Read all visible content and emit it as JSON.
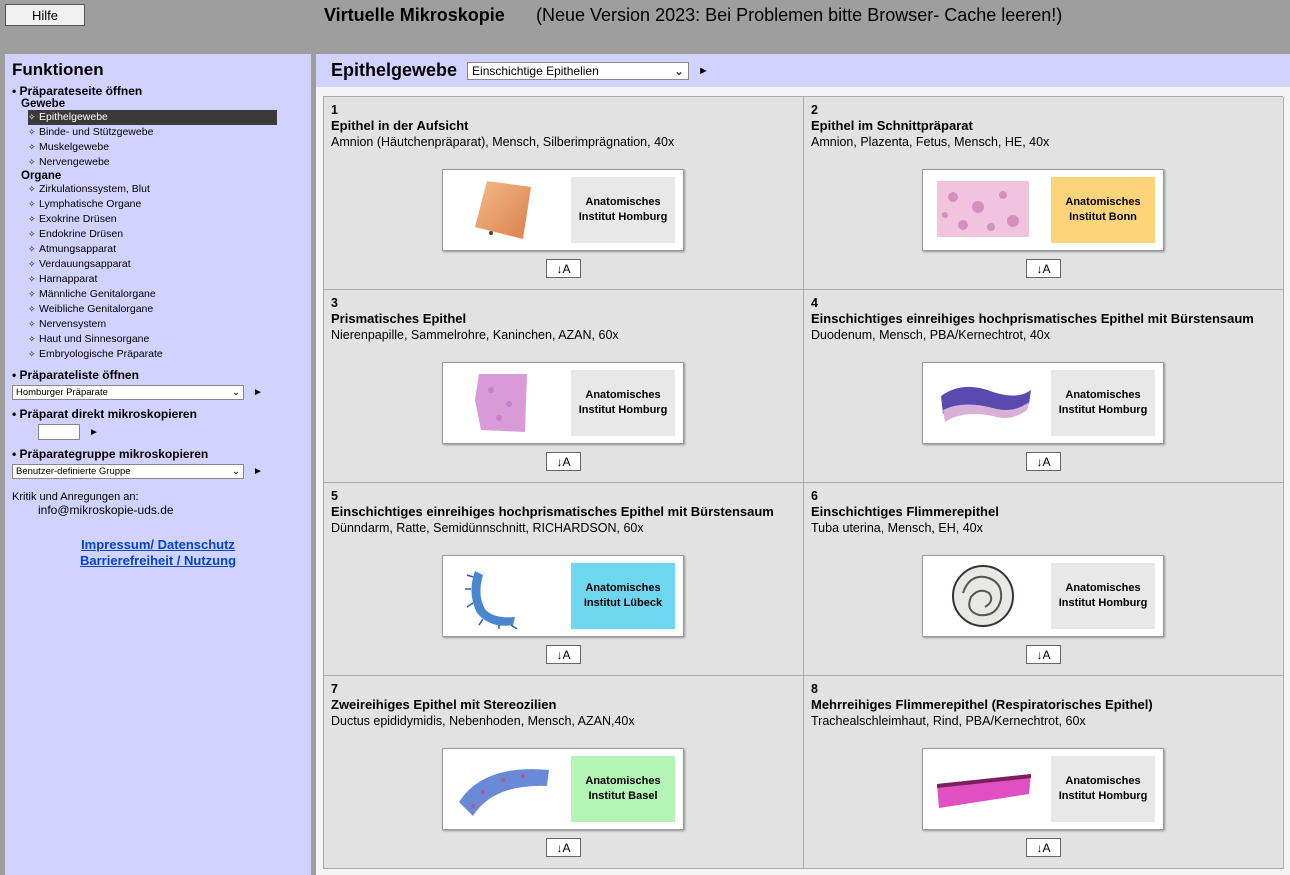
{
  "header": {
    "help_label": "Hilfe",
    "title": "Virtuelle Mikroskopie",
    "notice": "(Neue Version 2023: Bei Problemen bitte Browser- Cache leeren!)"
  },
  "sidebar": {
    "title": "Funktionen",
    "section_open_page": "• Präparateseite öffnen",
    "group_tissue": "Gewebe",
    "tissue_items": [
      "Epithelgewebe",
      "Binde- und Stützgewebe",
      "Muskelgewebe",
      "Nervengewebe"
    ],
    "group_organs": "Organe",
    "organ_items": [
      "Zirkulationssystem, Blut",
      "Lymphatische Organe",
      "Exokrine Drüsen",
      "Endokrine Drüsen",
      "Atmungsapparat",
      "Verdauungsapparat",
      "Harnapparat",
      "Männliche Genitalorgane",
      "Weibliche Genitalorgane",
      "Nervensystem",
      "Haut und Sinnesorgane",
      "Embryologische Präparate"
    ],
    "nav_bullet": "✧",
    "section_open_list": "• Präparateliste öffnen",
    "list_select_value": "Homburger Präparate",
    "section_direct": "• Präparat direkt mikroskopieren",
    "section_group": "• Präparategruppe mikroskopieren",
    "group_select_value": "Benutzer-definierte Gruppe",
    "contact_label": "Kritik und Anregungen an:",
    "contact_email": "info@mikroskopie-uds.de",
    "link_impressum": "Impressum/ Datenschutz",
    "link_barrier": "Barrierefreiheit / Nutzung",
    "play_glyph": "►",
    "dropdown_glyph": "⌄"
  },
  "main": {
    "title": "Epithelgewebe",
    "category_select": "Einschichtige Epithelien",
    "download_label": "↓A",
    "cards": [
      {
        "num": "1",
        "title": "Epithel in der Aufsicht",
        "desc": "Amnion (Häutchenpräparat), Mensch, Silberimprägnation, 40x",
        "institute": "Anatomisches\nInstitut Homburg",
        "badge_color": "#e8e8e8",
        "specimen": "amnion"
      },
      {
        "num": "2",
        "title": "Epithel im Schnittpräparat",
        "desc": "Amnion, Plazenta, Fetus, Mensch, HE, 40x",
        "institute": "Anatomisches\nInstitut Bonn",
        "badge_color": "#fdd479",
        "specimen": "placenta"
      },
      {
        "num": "3",
        "title": "Prismatisches Epithel",
        "desc": "Nierenpapille, Sammelrohre, Kaninchen, AZAN, 60x",
        "institute": "Anatomisches\nInstitut Homburg",
        "badge_color": "#e8e8e8",
        "specimen": "kidney"
      },
      {
        "num": "4",
        "title": "Einschichtiges einreihiges hochprismatisches Epithel mit Bürstensaum",
        "desc": "Duodenum, Mensch, PBA/Kernechtrot, 40x",
        "institute": "Anatomisches\nInstitut Homburg",
        "badge_color": "#e8e8e8",
        "specimen": "duodenum"
      },
      {
        "num": "5",
        "title": "Einschichtiges einreihiges hochprismatisches Epithel mit Bürstensaum",
        "desc": "Dünndarm, Ratte, Semidünnschnitt, RICHARDSON, 60x",
        "institute": "Anatomisches\nInstitut Lübeck",
        "badge_color": "#6fd6f0",
        "specimen": "intestine"
      },
      {
        "num": "6",
        "title": "Einschichtiges Flimmerepithel",
        "desc": "Tuba uterina, Mensch, EH, 40x",
        "institute": "Anatomisches\nInstitut Homburg",
        "badge_color": "#e8e8e8",
        "specimen": "tube"
      },
      {
        "num": "7",
        "title": "Zweireihiges Epithel mit Stereozilien",
        "desc": "Ductus epididymidis, Nebenhoden, Mensch, AZAN,40x",
        "institute": "Anatomisches\nInstitut Basel",
        "badge_color": "#b4f4b4",
        "specimen": "epididymis"
      },
      {
        "num": "8",
        "title": "Mehrreihiges Flimmerepithel (Respiratorisches Epithel)",
        "desc": "Trachealschleimhaut, Rind, PBA/Kernechtrot, 60x",
        "institute": "Anatomisches\nInstitut Homburg",
        "badge_color": "#e8e8e8",
        "specimen": "trachea"
      }
    ]
  }
}
